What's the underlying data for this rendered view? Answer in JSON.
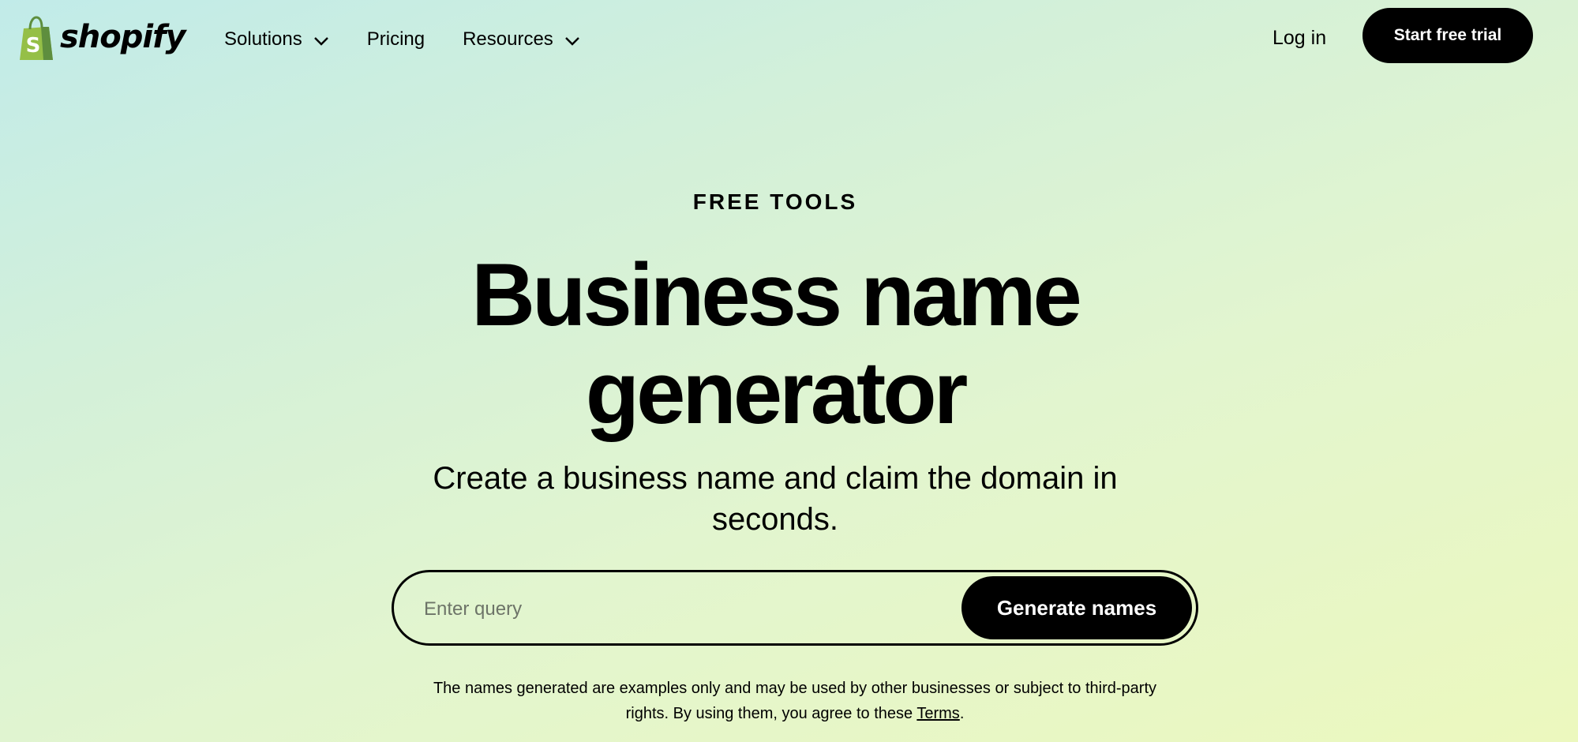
{
  "header": {
    "logo_text": "shopify",
    "logo_icon": "shopping-bag-icon",
    "nav": [
      {
        "label": "Solutions",
        "has_dropdown": true
      },
      {
        "label": "Pricing",
        "has_dropdown": false
      },
      {
        "label": "Resources",
        "has_dropdown": true
      }
    ],
    "login_label": "Log in",
    "cta_label": "Start free trial"
  },
  "hero": {
    "eyebrow": "FREE TOOLS",
    "title_line1": "Business name",
    "title_line2": "generator",
    "subtitle_line1": "Create a business name and claim the domain in",
    "subtitle_line2": "seconds."
  },
  "search": {
    "placeholder": "Enter query",
    "value": "",
    "button_label": "Generate names"
  },
  "disclaimer": {
    "line1": "The names generated are examples only and may be used by other businesses or subject to third-party",
    "line2_prefix": "rights. By using them, you agree to these",
    "terms_label": "Terms",
    "line2_suffix": "."
  },
  "colors": {
    "brand_green": "#95bf47",
    "brand_dark_green": "#5e8e3e",
    "button_bg": "#000000",
    "button_text": "#ffffff",
    "gradient_start": "#c1ebe9",
    "gradient_end": "#ecf8be"
  }
}
